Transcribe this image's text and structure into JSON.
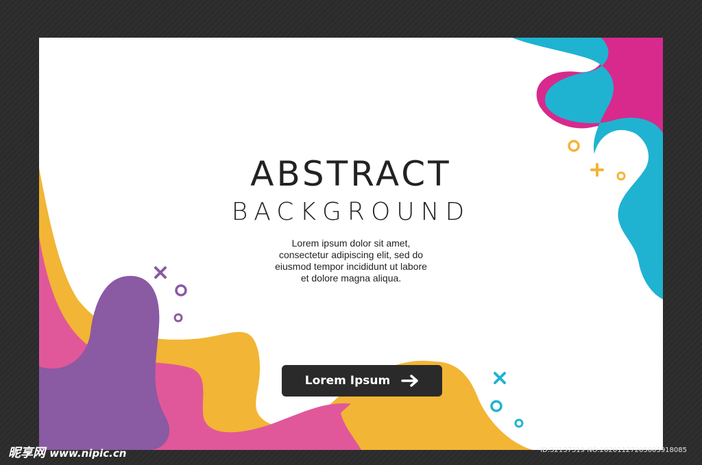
{
  "card": {
    "title_line1": "ABSTRACT",
    "title_line2": "BACKGROUND",
    "body_lines": [
      "Lorem ipsum dolor sit amet,",
      "consectetur adipiscing elit, sed do",
      "eiusmod tempor incididunt ut labore",
      "et dolore magna aliqua."
    ],
    "cta_label": "Lorem Ipsum",
    "cta_icon": "arrow-right-icon"
  },
  "watermark": {
    "logo_text": "昵享网",
    "url": "www.nipic.cn",
    "id_text": "ID:32137319 NO:20201127205605918085"
  },
  "colors": {
    "background": "#2b2b2b",
    "card": "#ffffff",
    "magenta": "#d72a8c",
    "cyan": "#1fb3d1",
    "yellow": "#f2b535",
    "pink": "#e0589a",
    "purple": "#8a5aa3",
    "button": "#2a2a2a"
  }
}
